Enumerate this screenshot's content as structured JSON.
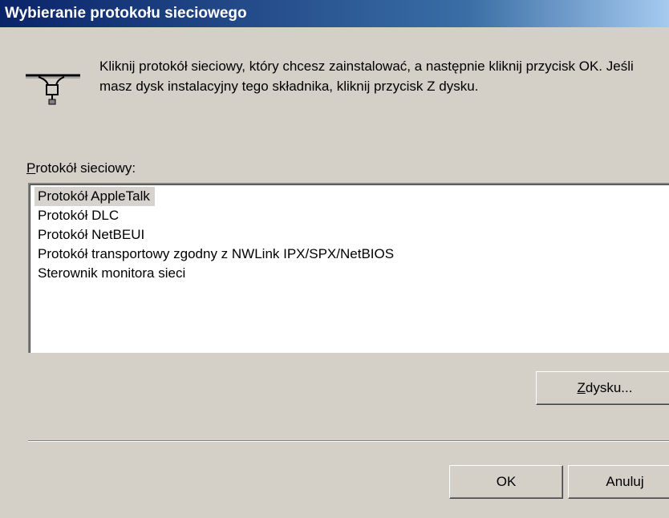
{
  "window": {
    "title": "Wybieranie protokołu sieciowego"
  },
  "description": "Kliknij protokół sieciowy, który chcesz zainstalować, a następnie kliknij przycisk OK. Jeśli masz dysk instalacyjny tego składnika, kliknij przycisk Z dysku.",
  "list": {
    "label_accel": "P",
    "label_rest": "rotokół sieciowy:",
    "items": [
      "Protokół AppleTalk",
      "Protokół DLC",
      "Protokół NetBEUI",
      "Protokół transportowy zgodny z NWLink IPX/SPX/NetBIOS",
      "Sterownik monitora sieci"
    ],
    "selected_index": 0
  },
  "buttons": {
    "z_dysku_accel": "Z",
    "z_dysku_rest": " dysku...",
    "ok": "OK",
    "cancel": "Anuluj"
  },
  "icons": {
    "network": "network-protocol-icon"
  },
  "colors": {
    "titlebar_start": "#0a246a",
    "titlebar_end": "#a6caf0",
    "face": "#d4d0c8"
  }
}
